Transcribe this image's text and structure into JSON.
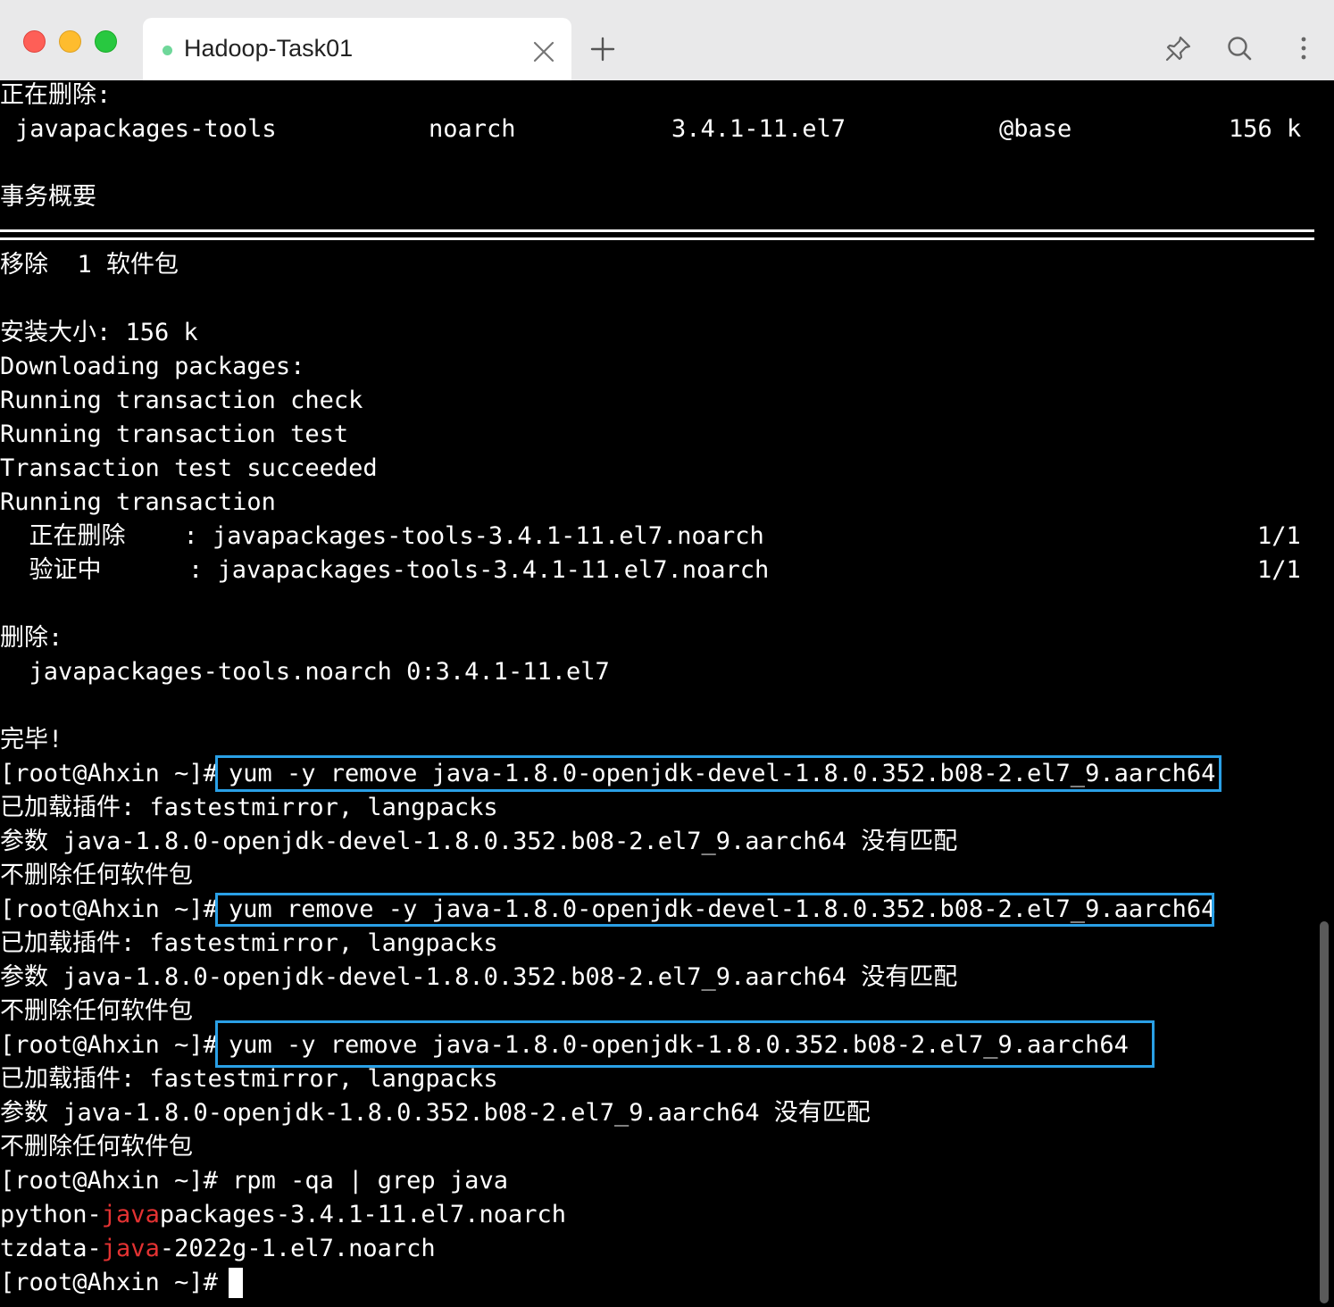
{
  "window": {
    "tab_title": "Hadoop-Task01",
    "status_color": "#6fd79a"
  },
  "icons": {
    "close": "close-icon",
    "new_tab": "plus-icon",
    "pin": "pin-icon",
    "search": "search-icon",
    "more": "more-vertical-icon"
  },
  "terminal": {
    "removing_header": "正在删除:",
    "pkg_row": {
      "name": "javapackages-tools",
      "arch": "noarch",
      "version": "3.4.1-11.el7",
      "repo": "@base",
      "size": "156 k"
    },
    "summary_header": "事务概要",
    "remove_count": "移除  1 软件包",
    "install_size": "安装大小: 156 k",
    "downloading": "Downloading packages:",
    "check": "Running transaction check",
    "test": "Running transaction test",
    "succeeded": "Transaction test succeeded",
    "running": "Running transaction",
    "step_erase": {
      "label": "  正在删除    : javapackages-tools-3.4.1-11.el7.noarch",
      "progress": "1/1"
    },
    "step_verify": {
      "label": "  验证中      : javapackages-tools-3.4.1-11.el7.noarch",
      "progress": "1/1"
    },
    "removed_header": "删除:",
    "removed_item": "  javapackages-tools.noarch 0:3.4.1-11.el7",
    "done": "完毕!",
    "prompt": "[root@Ahxin ~]#",
    "cmd1": "yum -y remove java-1.8.0-openjdk-devel-1.8.0.352.b08-2.el7_9.aarch64",
    "plugins": "已加载插件: fastestmirror, langpacks",
    "nomatch1": "参数 java-1.8.0-openjdk-devel-1.8.0.352.b08-2.el7_9.aarch64 没有匹配",
    "nothing": "不删除任何软件包",
    "cmd2": "yum remove -y java-1.8.0-openjdk-devel-1.8.0.352.b08-2.el7_9.aarch64",
    "cmd3": "yum -y remove java-1.8.0-openjdk-1.8.0.352.b08-2.el7_9.aarch64",
    "nomatch3": "参数 java-1.8.0-openjdk-1.8.0.352.b08-2.el7_9.aarch64 没有匹配",
    "cmd4": " rpm -qa | grep java",
    "result1": {
      "pre": "python-",
      "match": "java",
      "post": "packages-3.4.1-11.el7.noarch"
    },
    "result2": {
      "pre": "tzdata-",
      "match": "java",
      "post": "-2022g-1.el7.noarch"
    },
    "highlight_box_color": "#2aa0e6",
    "grep_match_color": "#e33232"
  }
}
